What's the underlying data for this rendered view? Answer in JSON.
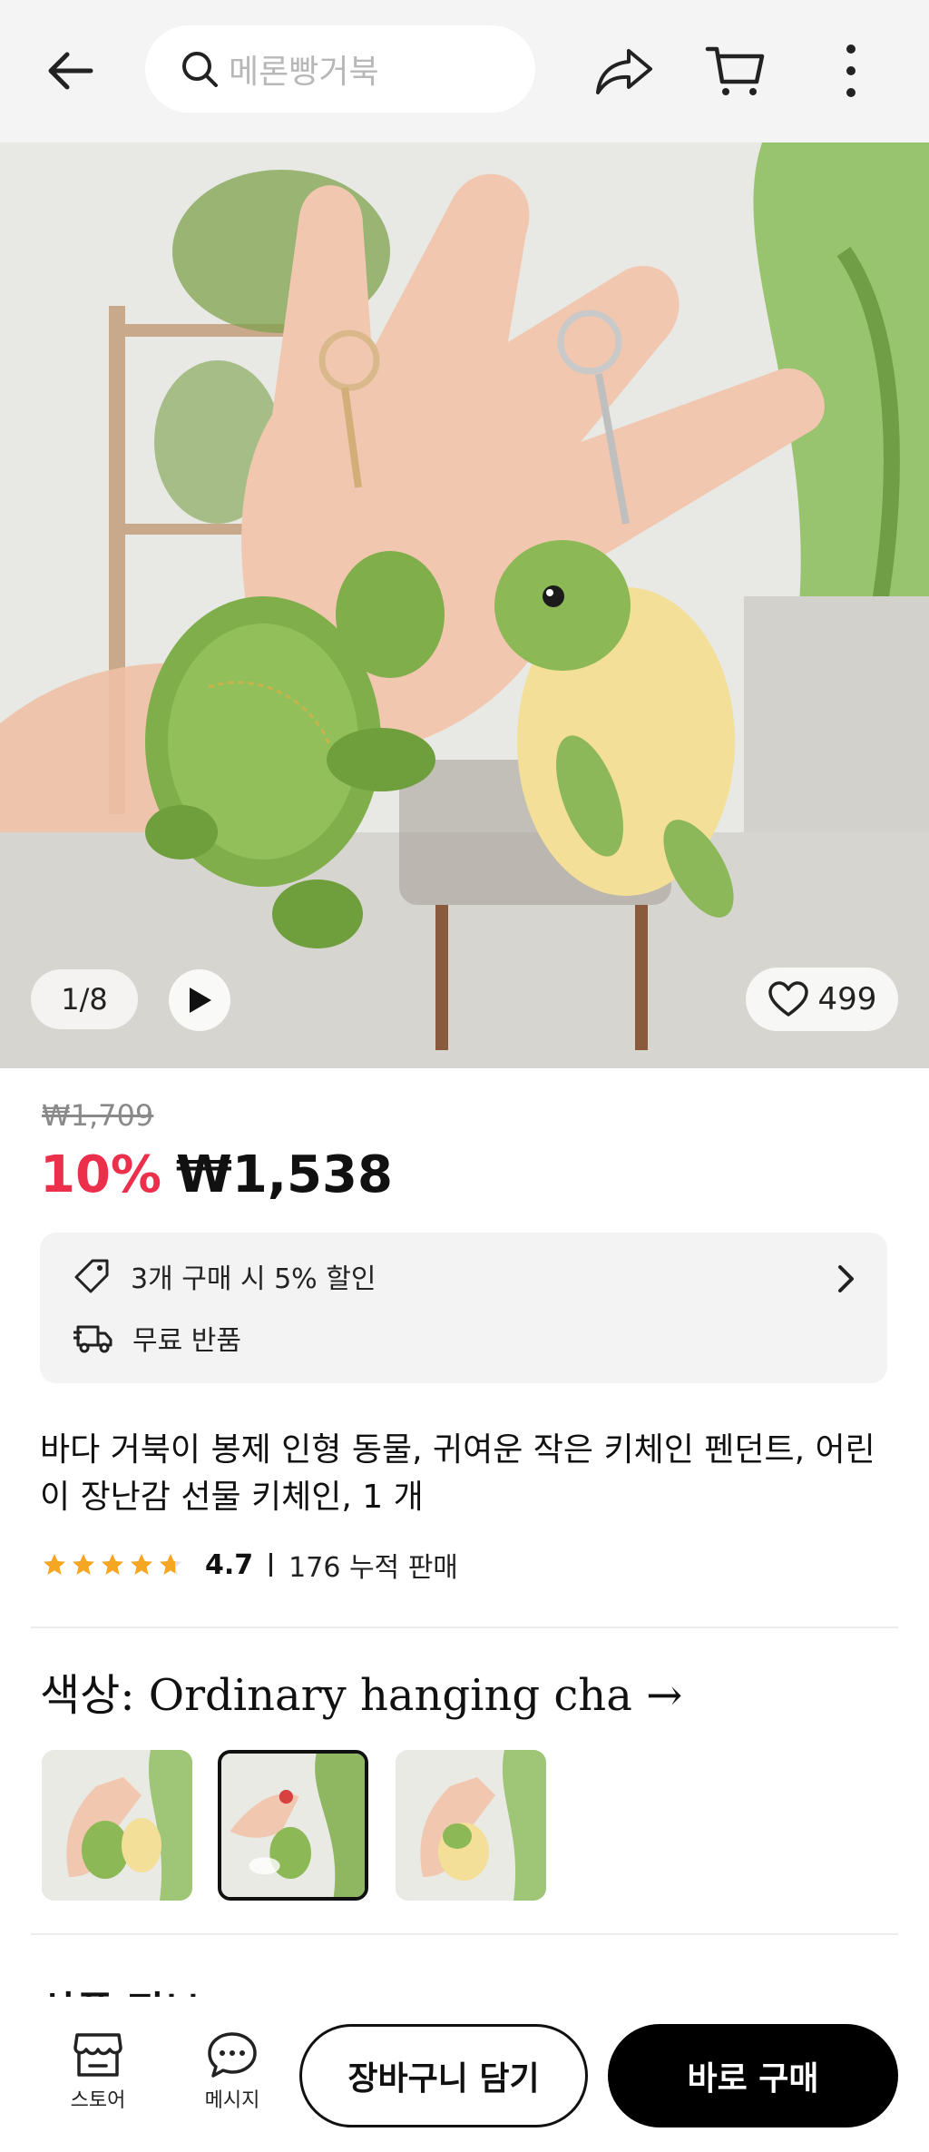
{
  "header": {
    "search_placeholder": "메론빵거북"
  },
  "gallery": {
    "pager": "1/8",
    "likes": "499"
  },
  "price": {
    "original": "₩1,709",
    "discount": "10%",
    "current": "₩1,538"
  },
  "promo": {
    "bulk_discount": "3개 구매 시 5% 할인",
    "free_return": "무료 반품"
  },
  "product": {
    "title": "바다 거북이 봉제 인형 동물, 귀여운 작은 키체인 펜던트, 어린이 장난감 선물 키체인, 1 개",
    "rating": "4.7",
    "rating_fraction": 0.94,
    "sold": "176 누적 판매"
  },
  "options": {
    "color_label": "색상: Ordinary hanging cha →",
    "selected_index": 1,
    "thumb_count": 3
  },
  "section_peek": "상품 정보 >",
  "bottom": {
    "store_label": "스토어",
    "message_label": "메시지",
    "add_to_cart": "장바구니 담기",
    "buy_now": "바로 구매"
  },
  "colors": {
    "discount": "#ec2f4b",
    "star": "#f5a623",
    "buy_button": "#000000"
  },
  "icons": [
    "back-arrow-icon",
    "search-icon",
    "share-icon",
    "cart-icon",
    "more-vertical-icon",
    "play-icon",
    "heart-icon",
    "tag-icon",
    "truck-icon",
    "chevron-right-icon",
    "star-icon",
    "store-icon",
    "chat-icon"
  ]
}
